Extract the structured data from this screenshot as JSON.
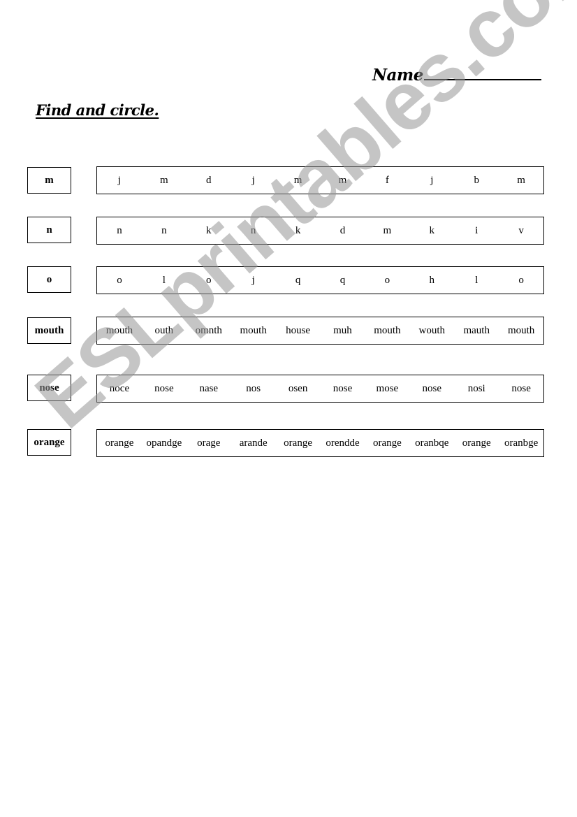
{
  "header": {
    "name_label": "Name",
    "instruction": "Find and circle."
  },
  "watermark": "ESLprintables.com",
  "rows": [
    {
      "target": "m",
      "choices": [
        "j",
        "m",
        "d",
        "j",
        "m",
        "m",
        "f",
        "j",
        "b",
        "m"
      ]
    },
    {
      "target": "n",
      "choices": [
        "n",
        "n",
        "k",
        "n",
        "k",
        "d",
        "m",
        "k",
        "i",
        "v"
      ]
    },
    {
      "target": "o",
      "choices": [
        "o",
        "l",
        "o",
        "j",
        "q",
        "q",
        "o",
        "h",
        "l",
        "o"
      ]
    },
    {
      "target": "mouth",
      "choices": [
        "mouth",
        "outh",
        "omnth",
        "mouth",
        "house",
        "muh",
        "mouth",
        "wouth",
        "mauth",
        "mouth"
      ]
    },
    {
      "target": "nose",
      "choices": [
        "noce",
        "nose",
        "nase",
        "nos",
        "osen",
        "nose",
        "mose",
        "nose",
        "nosi",
        "nose"
      ]
    },
    {
      "target": "orange",
      "choices": [
        "orange",
        "opandge",
        "orage",
        "arande",
        "orange",
        "orendde",
        "orange",
        "oranbqe",
        "orange",
        "oranbge"
      ]
    }
  ]
}
